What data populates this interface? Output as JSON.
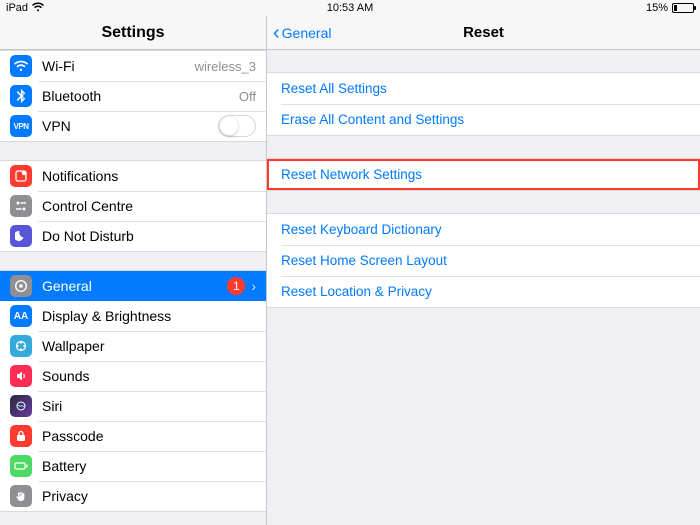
{
  "statusbar": {
    "device": "iPad",
    "time": "10:53 AM",
    "battery_text": "15%",
    "battery_level": 15
  },
  "sidebar": {
    "title": "Settings",
    "groups": [
      [
        {
          "label": "Wi-Fi",
          "detail": "wireless_3"
        },
        {
          "label": "Bluetooth",
          "detail": "Off"
        },
        {
          "label": "VPN",
          "toggle": false
        }
      ],
      [
        {
          "label": "Notifications"
        },
        {
          "label": "Control Centre"
        },
        {
          "label": "Do Not Disturb"
        }
      ],
      [
        {
          "label": "General",
          "badge": "1",
          "selected": true
        },
        {
          "label": "Display & Brightness"
        },
        {
          "label": "Wallpaper"
        },
        {
          "label": "Sounds"
        },
        {
          "label": "Siri"
        },
        {
          "label": "Passcode"
        },
        {
          "label": "Battery"
        },
        {
          "label": "Privacy"
        }
      ]
    ]
  },
  "detail": {
    "back_label": "General",
    "title": "Reset",
    "groups": [
      [
        "Reset All Settings",
        "Erase All Content and Settings"
      ],
      [
        "Reset Network Settings"
      ],
      [
        "Reset Keyboard Dictionary",
        "Reset Home Screen Layout",
        "Reset Location & Privacy"
      ]
    ],
    "highlighted_item": "Reset Network Settings"
  },
  "colors": {
    "link": "#007aff",
    "selected_bg": "#007aff",
    "badge": "#ff3b30",
    "highlight_border": "#ff3b30"
  }
}
